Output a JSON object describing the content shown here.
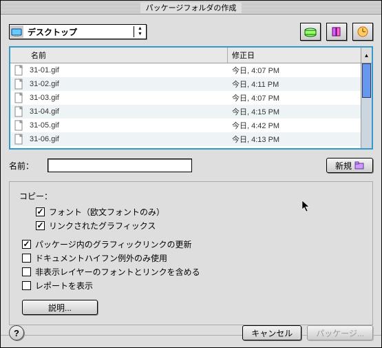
{
  "window": {
    "title": "パッケージフォルダの作成"
  },
  "location": {
    "label": "デスクトップ"
  },
  "columns": {
    "name": "名前",
    "modified": "修正日"
  },
  "files": [
    {
      "name": "31-01.gif",
      "date": "今日, 4:07 PM"
    },
    {
      "name": "31-02.gif",
      "date": "今日, 4:11 PM"
    },
    {
      "name": "31-03.gif",
      "date": "今日, 4:07 PM"
    },
    {
      "name": "31-04.gif",
      "date": "今日, 4:15 PM"
    },
    {
      "name": "31-05.gif",
      "date": "今日, 4:42 PM"
    },
    {
      "name": "31-06.gif",
      "date": "今日, 4:13 PM"
    }
  ],
  "name_field": {
    "label": "名前：",
    "value": ""
  },
  "buttons": {
    "new": "新規",
    "explain": "説明...",
    "cancel": "キャンセル",
    "package": "パッケージ..."
  },
  "options": {
    "copy_title": "コピー：",
    "font_roman": "フォント（欧文フォントのみ）",
    "linked_graphics": "リンクされたグラフィックス",
    "update_links": "パッケージ内のグラフィックリンクの更新",
    "hyphen_exceptions": "ドキュメントハイフン例外のみ使用",
    "hidden_layers": "非表示レイヤーのフォントとリンクを含める",
    "show_report": "レポートを表示"
  },
  "checked": {
    "font_roman": true,
    "linked_graphics": true,
    "update_links": true,
    "hyphen_exceptions": false,
    "hidden_layers": false,
    "show_report": false
  }
}
